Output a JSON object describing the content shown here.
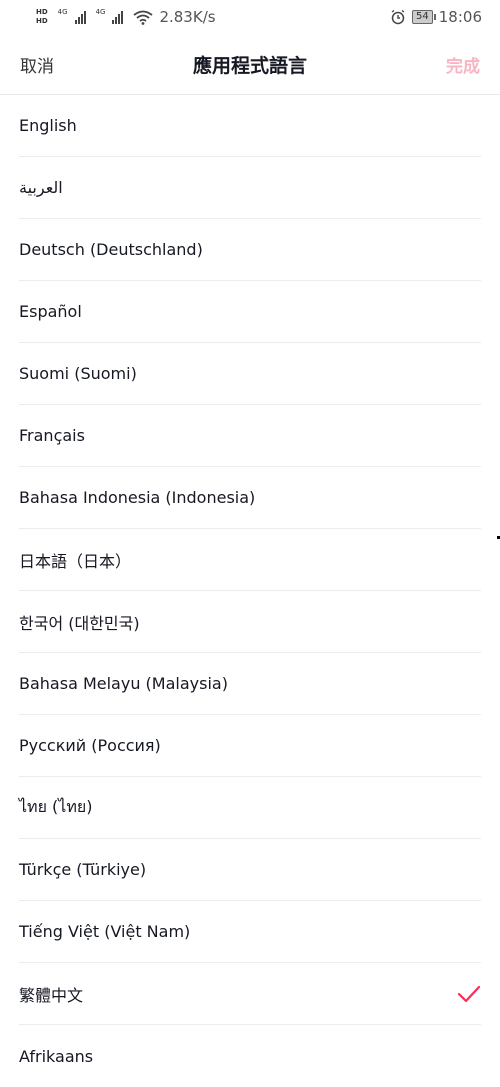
{
  "status_bar": {
    "hd_top": "HD",
    "hd_bottom": "HD",
    "sig1_label": "4G",
    "sig2_label": "4G",
    "speed": "2.83K/s",
    "battery": "54",
    "time": "18:06",
    "icons": [
      "hd-icon",
      "signal-icon",
      "wifi-icon",
      "alarm-icon",
      "battery-icon"
    ]
  },
  "header": {
    "cancel_label": "取消",
    "title": "應用程式語言",
    "done_label": "完成"
  },
  "languages": [
    "English",
    "العربية",
    "Deutsch (Deutschland)",
    "Español",
    "Suomi (Suomi)",
    "Français",
    "Bahasa Indonesia (Indonesia)",
    "日本語（日本）",
    "한국어 (대한민국)",
    "Bahasa Melayu (Malaysia)",
    "Русский (Россия)",
    "ไทย (ไทย)",
    "Türkçe (Türkiye)",
    "Tiếng Việt (Việt Nam)",
    "繁體中文",
    "Afrikaans"
  ],
  "selected_language_index": 14,
  "colors": {
    "accent": "#fe2c55",
    "done_disabled": "#f9b4c3",
    "text": "#161823",
    "divider": "#ececec"
  }
}
